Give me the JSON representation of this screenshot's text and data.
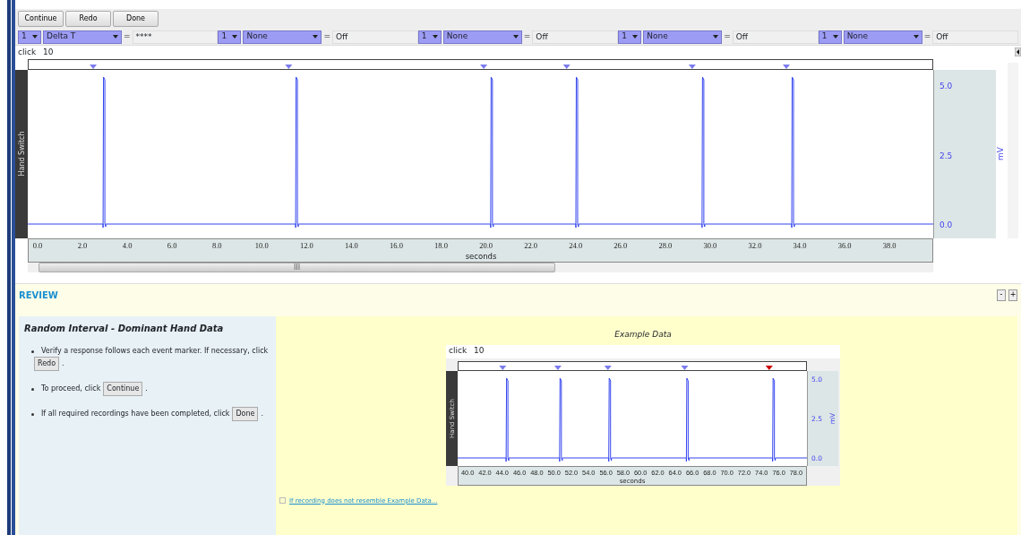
{
  "toolbar": {
    "buttons": [
      "Continue",
      "Redo",
      "Done"
    ]
  },
  "measurements": [
    {
      "channel": "1",
      "function": "Delta T",
      "equals": "=",
      "value": "****"
    },
    {
      "channel": "1",
      "function": "None",
      "equals": "=",
      "value": "Off"
    },
    {
      "channel": "1",
      "function": "None",
      "equals": "=",
      "value": "Off"
    },
    {
      "channel": "1",
      "function": "None",
      "equals": "=",
      "value": "Off"
    },
    {
      "channel": "1",
      "function": "None",
      "equals": "=",
      "value": "Off"
    }
  ],
  "channel_bar": {
    "label": "click",
    "value": "10"
  },
  "chart": {
    "channel_label": "Hand Switch",
    "unit": "mV",
    "y_ticks": [
      "5.0",
      "2.5",
      "0.0"
    ],
    "x_ticks": [
      "0.0",
      "2.0",
      "4.0",
      "6.0",
      "8.0",
      "10.0",
      "12.0",
      "14.0",
      "16.0",
      "18.0",
      "20.0",
      "22.0",
      "24.0",
      "26.0",
      "28.0",
      "30.0",
      "32.0",
      "34.0",
      "36.0",
      "38.0"
    ],
    "x_label": "seconds",
    "scroll_grip": "III"
  },
  "review": {
    "title": "REVIEW",
    "collapse_button": "-",
    "expand_button": "+",
    "panel_title": "Random Interval - Dominant Hand Data",
    "steps": [
      {
        "text": "Verify a response follows each event marker. If necessary, click",
        "button": "Redo",
        "after": "."
      },
      {
        "text": "To proceed, click",
        "button": "Continue",
        "after": "."
      },
      {
        "text": "If all required recordings have been completed, click",
        "button": "Done",
        "after": "."
      }
    ],
    "example": {
      "title": "Example Data",
      "channel_bar": {
        "label": "click",
        "value": "10"
      },
      "channel_label": "Hand Switch",
      "unit": "mV",
      "y_ticks": [
        "5.0",
        "2.5",
        "0.0"
      ],
      "x_ticks": [
        "40.0",
        "42.0",
        "44.0",
        "46.0",
        "48.0",
        "50.0",
        "52.0",
        "54.0",
        "56.0",
        "58.0",
        "60.0",
        "62.0",
        "64.0",
        "66.0",
        "68.0",
        "70.0",
        "72.0",
        "74.0",
        "76.0",
        "78.0"
      ],
      "x_label": "seconds",
      "markers": [
        {
          "color": "#7b7bef"
        },
        {
          "color": "#7b7bef"
        },
        {
          "color": "#7b7bef"
        },
        {
          "color": "#7b7bef"
        },
        {
          "color": "#cc0000"
        }
      ]
    },
    "link": "If recording does not resemble Example Data..."
  }
}
